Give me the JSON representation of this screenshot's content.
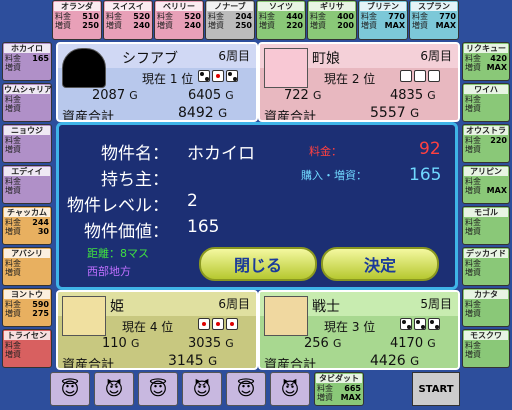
{
  "top_tiles": [
    {
      "name": "オランダ",
      "fee": "510",
      "buy": "250",
      "cls": "t-pink"
    },
    {
      "name": "スイスイ",
      "fee": "520",
      "buy": "240",
      "cls": "t-pink"
    },
    {
      "name": "ベリリー",
      "fee": "520",
      "buy": "240",
      "cls": "t-pink"
    },
    {
      "name": "ノナーブ",
      "fee": "204",
      "buy": "250",
      "cls": "t-grey"
    },
    {
      "name": "ソイツ",
      "fee": "440",
      "buy": "220",
      "cls": "t-green"
    },
    {
      "name": "ギリサ",
      "fee": "400",
      "buy": "200",
      "cls": "t-green"
    },
    {
      "name": "ブリテン",
      "fee": "770",
      "buy": "MAX",
      "cls": "t-cyan"
    },
    {
      "name": "スプラン",
      "fee": "770",
      "buy": "MAX",
      "cls": "t-cyan"
    }
  ],
  "left_tiles": [
    {
      "name": "ホカイロ",
      "fee": "165",
      "buy": "",
      "cls": "t-purple"
    },
    {
      "name": "ウムシャリア",
      "fee": "",
      "buy": "",
      "cls": "t-purple"
    },
    {
      "name": "ニョウジ",
      "fee": "",
      "buy": "",
      "cls": "t-purple"
    },
    {
      "name": "エディイ",
      "fee": "",
      "buy": "",
      "cls": "t-purple"
    },
    {
      "name": "チャッカム",
      "fee": "244",
      "buy": "30",
      "cls": "t-orange"
    },
    {
      "name": "アバシリ",
      "fee": "",
      "buy": "",
      "cls": "t-orange"
    },
    {
      "name": "ヨントウ",
      "fee": "590",
      "buy": "275",
      "cls": "t-orange"
    },
    {
      "name": "トライセン",
      "fee": "",
      "buy": "",
      "cls": "t-red"
    }
  ],
  "right_tiles": [
    {
      "name": "リクキュー",
      "fee": "420",
      "buy": "MAX",
      "cls": "t-green"
    },
    {
      "name": "ワイハ",
      "fee": "",
      "buy": "",
      "cls": "t-green"
    },
    {
      "name": "オウストラ",
      "fee": "220",
      "buy": "",
      "cls": "t-green"
    },
    {
      "name": "アリピン",
      "fee": "",
      "buy": "MAX",
      "cls": "t-green"
    },
    {
      "name": "モゴル",
      "fee": "",
      "buy": "",
      "cls": "t-green"
    },
    {
      "name": "デッカイド",
      "fee": "",
      "buy": "",
      "cls": "t-green"
    },
    {
      "name": "カナタ",
      "fee": "",
      "buy": "",
      "cls": "t-green"
    },
    {
      "name": "モスクワ",
      "fee": "",
      "buy": "",
      "cls": "t-green"
    }
  ],
  "players": {
    "p1": {
      "name": "シフアブ",
      "week": "6周目",
      "rank_label": "現在 1 位",
      "money": "2087",
      "assets": "6405",
      "total_label": "資産合計",
      "total": "8492"
    },
    "p2": {
      "name": "町娘",
      "week": "6周目",
      "rank_label": "現在 2 位",
      "money": "722",
      "assets": "4835",
      "total_label": "資産合計",
      "total": "5557"
    },
    "p3": {
      "name": "姫",
      "week": "6周目",
      "rank_label": "現在 4 位",
      "money": "110",
      "assets": "3035",
      "total_label": "資産合計",
      "total": "3145"
    },
    "p4": {
      "name": "戦士",
      "week": "5周目",
      "rank_label": "現在 3 位",
      "money": "256",
      "assets": "4170",
      "total_label": "資産合計",
      "total": "4426"
    }
  },
  "currency": "G",
  "dialog": {
    "name_label": "物件名：",
    "name_value": "ホカイロ",
    "owner_label": "持ち主：",
    "owner_value": "",
    "level_label": "物件レベル：",
    "level_value": "2",
    "price_label": "物件価値：",
    "price_value": "165",
    "fee_label": "料金：",
    "fee_value": "92",
    "buy_label": "購入・増資：",
    "buy_value": "165",
    "distance": "距離：8マス",
    "region": "西部地方",
    "close_btn": "閉じる",
    "ok_btn": "決定"
  },
  "bottom": {
    "tile_name": "タビダット",
    "tile_fee": "665",
    "tile_buy": "MAX",
    "start": "START"
  }
}
